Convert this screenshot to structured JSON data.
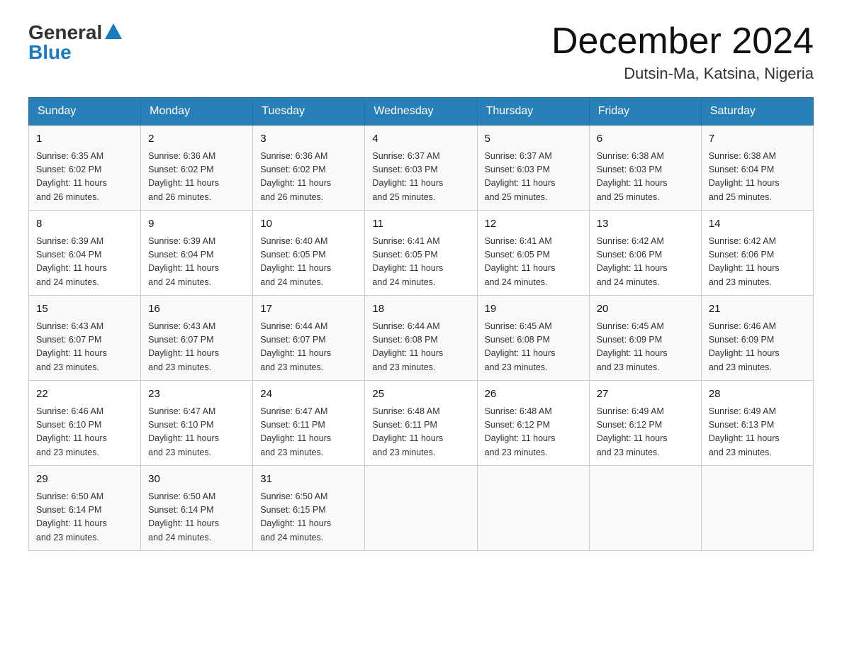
{
  "header": {
    "logo_general": "General",
    "logo_blue": "Blue",
    "month_title": "December 2024",
    "location": "Dutsin-Ma, Katsina, Nigeria"
  },
  "days_of_week": [
    "Sunday",
    "Monday",
    "Tuesday",
    "Wednesday",
    "Thursday",
    "Friday",
    "Saturday"
  ],
  "weeks": [
    [
      {
        "day": "1",
        "sunrise": "6:35 AM",
        "sunset": "6:02 PM",
        "daylight": "11 hours and 26 minutes."
      },
      {
        "day": "2",
        "sunrise": "6:36 AM",
        "sunset": "6:02 PM",
        "daylight": "11 hours and 26 minutes."
      },
      {
        "day": "3",
        "sunrise": "6:36 AM",
        "sunset": "6:02 PM",
        "daylight": "11 hours and 26 minutes."
      },
      {
        "day": "4",
        "sunrise": "6:37 AM",
        "sunset": "6:03 PM",
        "daylight": "11 hours and 25 minutes."
      },
      {
        "day": "5",
        "sunrise": "6:37 AM",
        "sunset": "6:03 PM",
        "daylight": "11 hours and 25 minutes."
      },
      {
        "day": "6",
        "sunrise": "6:38 AM",
        "sunset": "6:03 PM",
        "daylight": "11 hours and 25 minutes."
      },
      {
        "day": "7",
        "sunrise": "6:38 AM",
        "sunset": "6:04 PM",
        "daylight": "11 hours and 25 minutes."
      }
    ],
    [
      {
        "day": "8",
        "sunrise": "6:39 AM",
        "sunset": "6:04 PM",
        "daylight": "11 hours and 24 minutes."
      },
      {
        "day": "9",
        "sunrise": "6:39 AM",
        "sunset": "6:04 PM",
        "daylight": "11 hours and 24 minutes."
      },
      {
        "day": "10",
        "sunrise": "6:40 AM",
        "sunset": "6:05 PM",
        "daylight": "11 hours and 24 minutes."
      },
      {
        "day": "11",
        "sunrise": "6:41 AM",
        "sunset": "6:05 PM",
        "daylight": "11 hours and 24 minutes."
      },
      {
        "day": "12",
        "sunrise": "6:41 AM",
        "sunset": "6:05 PM",
        "daylight": "11 hours and 24 minutes."
      },
      {
        "day": "13",
        "sunrise": "6:42 AM",
        "sunset": "6:06 PM",
        "daylight": "11 hours and 24 minutes."
      },
      {
        "day": "14",
        "sunrise": "6:42 AM",
        "sunset": "6:06 PM",
        "daylight": "11 hours and 23 minutes."
      }
    ],
    [
      {
        "day": "15",
        "sunrise": "6:43 AM",
        "sunset": "6:07 PM",
        "daylight": "11 hours and 23 minutes."
      },
      {
        "day": "16",
        "sunrise": "6:43 AM",
        "sunset": "6:07 PM",
        "daylight": "11 hours and 23 minutes."
      },
      {
        "day": "17",
        "sunrise": "6:44 AM",
        "sunset": "6:07 PM",
        "daylight": "11 hours and 23 minutes."
      },
      {
        "day": "18",
        "sunrise": "6:44 AM",
        "sunset": "6:08 PM",
        "daylight": "11 hours and 23 minutes."
      },
      {
        "day": "19",
        "sunrise": "6:45 AM",
        "sunset": "6:08 PM",
        "daylight": "11 hours and 23 minutes."
      },
      {
        "day": "20",
        "sunrise": "6:45 AM",
        "sunset": "6:09 PM",
        "daylight": "11 hours and 23 minutes."
      },
      {
        "day": "21",
        "sunrise": "6:46 AM",
        "sunset": "6:09 PM",
        "daylight": "11 hours and 23 minutes."
      }
    ],
    [
      {
        "day": "22",
        "sunrise": "6:46 AM",
        "sunset": "6:10 PM",
        "daylight": "11 hours and 23 minutes."
      },
      {
        "day": "23",
        "sunrise": "6:47 AM",
        "sunset": "6:10 PM",
        "daylight": "11 hours and 23 minutes."
      },
      {
        "day": "24",
        "sunrise": "6:47 AM",
        "sunset": "6:11 PM",
        "daylight": "11 hours and 23 minutes."
      },
      {
        "day": "25",
        "sunrise": "6:48 AM",
        "sunset": "6:11 PM",
        "daylight": "11 hours and 23 minutes."
      },
      {
        "day": "26",
        "sunrise": "6:48 AM",
        "sunset": "6:12 PM",
        "daylight": "11 hours and 23 minutes."
      },
      {
        "day": "27",
        "sunrise": "6:49 AM",
        "sunset": "6:12 PM",
        "daylight": "11 hours and 23 minutes."
      },
      {
        "day": "28",
        "sunrise": "6:49 AM",
        "sunset": "6:13 PM",
        "daylight": "11 hours and 23 minutes."
      }
    ],
    [
      {
        "day": "29",
        "sunrise": "6:50 AM",
        "sunset": "6:14 PM",
        "daylight": "11 hours and 23 minutes."
      },
      {
        "day": "30",
        "sunrise": "6:50 AM",
        "sunset": "6:14 PM",
        "daylight": "11 hours and 24 minutes."
      },
      {
        "day": "31",
        "sunrise": "6:50 AM",
        "sunset": "6:15 PM",
        "daylight": "11 hours and 24 minutes."
      },
      null,
      null,
      null,
      null
    ]
  ],
  "labels": {
    "sunrise": "Sunrise:",
    "sunset": "Sunset:",
    "daylight": "Daylight:"
  }
}
